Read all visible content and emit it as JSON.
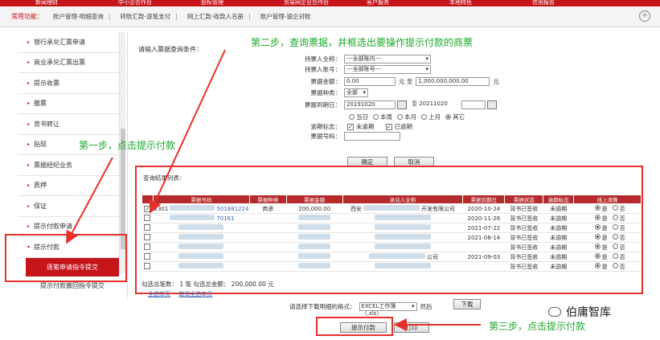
{
  "top_nav": [
    "新闻理财",
    "中小企合作台",
    "投标管理",
    "贸易网企业合作台",
    "客户服务",
    "本地特色",
    "信用报告"
  ],
  "shortcut": {
    "label": "常用功能：",
    "items": [
      "账户管理-明细查询",
      "转账汇款-逐笔支付",
      "网上汇款-收款人名册",
      "账户管理-银企对账"
    ]
  },
  "sidebar": {
    "items": [
      "银行承兑汇票申请",
      "商业承兑汇票出票",
      "提示收票",
      "撤票",
      "背书转让",
      "贴现",
      "票据经纪业务",
      "质押",
      "保证",
      "提示付款申请",
      "提示付款"
    ],
    "sub_items": [
      "逐笔申请指令提交",
      "提示付款撤回指令提交"
    ]
  },
  "form": {
    "title": "请输入票据查询条件：",
    "acceptor_name_label": "持票人全称：",
    "acceptor_name_value": "---全部账内---",
    "acceptor_acct_label": "持票人账号：",
    "acceptor_acct_value": "---全部账号---",
    "amount_label": "票据金额：",
    "amount_from": "0.00",
    "amount_unit": "元 至",
    "amount_to": "1,000,000,000.00",
    "amount_unit2": "元",
    "type_label": "票据种类：",
    "type_value": "全部",
    "due_label": "票据到期日：",
    "due_from": "20191020",
    "due_to": "至 20211020",
    "periods": [
      "当日",
      "本周",
      "本月",
      "上月",
      "其它"
    ],
    "expired_label": "逾期标志：",
    "expired_opts": [
      "未逾期",
      "已逾期"
    ],
    "bill_no_label": "票据号码：",
    "confirm": "确定",
    "cancel": "取消"
  },
  "result": {
    "title": "查询结果列表：",
    "headers": [
      "",
      "票据号码",
      "票据种类",
      "票据金额",
      "承兑人全称",
      "票据到期日",
      "票据状态",
      "逾期标志",
      "线上清算"
    ],
    "rows": [
      {
        "no_start": "2301",
        "no_end": "501881224",
        "kind": "商承",
        "amount": "200,000.00",
        "acceptor": "西安",
        "acceptor_end": "开发有限公司",
        "due": "2020-10-24",
        "status": "背书已签收",
        "overdue": "未逾期",
        "checked": "✓"
      },
      {
        "no_start": "",
        "no_end": "70161",
        "kind": "",
        "amount": "",
        "acceptor": "",
        "acceptor_end": "",
        "due": "2020-11-26",
        "status": "背书已签收",
        "overdue": "未逾期",
        "checked": ""
      },
      {
        "no_start": "",
        "no_end": "",
        "kind": "",
        "amount": "",
        "acceptor": "",
        "acceptor_end": "",
        "due": "2021-07-22",
        "status": "背书已签收",
        "overdue": "未逾期",
        "checked": ""
      },
      {
        "no_start": "",
        "no_end": "",
        "kind": "",
        "amount": "",
        "acceptor": "",
        "acceptor_end": "",
        "due": "2021-08-14",
        "status": "背书已签收",
        "overdue": "未逾期",
        "checked": ""
      },
      {
        "no_start": "",
        "no_end": "",
        "kind": "",
        "amount": "",
        "acceptor": "",
        "acceptor_end": "",
        "due": "",
        "status": "背书已签收",
        "overdue": "未逾期",
        "checked": ""
      },
      {
        "no_start": "",
        "no_end": "",
        "kind": "",
        "amount": "",
        "acceptor": "",
        "acceptor_end": "公司",
        "due": "2021-09-03",
        "status": "背书已签收",
        "overdue": "未逾期",
        "checked": ""
      },
      {
        "no_start": "",
        "no_end": "",
        "kind": "",
        "amount": "",
        "acceptor": "",
        "acceptor_end": "",
        "due": "",
        "status": "背书已签收",
        "overdue": "未逾期",
        "checked": ""
      }
    ],
    "clear_yes": "是",
    "clear_no": "否",
    "summary": "勾选总笔数： 1 笔  勾选总金额： 200,000.00 元",
    "select_all": "全选本页",
    "unselect": "取消全选本页"
  },
  "export": {
    "label": "请选择下载明细的格式：",
    "format": "EXCEL工作簿（.xls）",
    "then": "然后",
    "download": "下载"
  },
  "actions": {
    "submit": "提示付款",
    "print": "打印"
  },
  "notes": {
    "step1": "第一步，点击提示付款",
    "step2": "第二步，查询票据，并框选出要操作提示付款的商票",
    "step3": "第三步，点击提示付款"
  },
  "watermark": "伯庸智库",
  "colors": {
    "brand": "#c6141b",
    "annotation": "#e8302b",
    "note": "#1aa82a"
  }
}
